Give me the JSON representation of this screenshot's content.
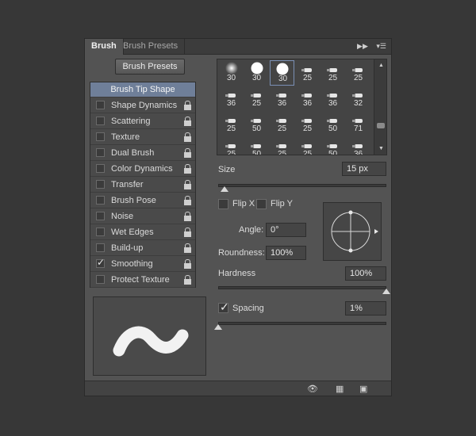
{
  "tabs": {
    "active": "Brush",
    "inactive": "Brush Presets"
  },
  "header_icons": {
    "collapse": "double-arrow-icon",
    "menu": "panel-menu-icon"
  },
  "presets_button": "Brush Presets",
  "list": {
    "header": "Brush Tip Shape",
    "items": [
      {
        "label": "Shape Dynamics",
        "checked": false
      },
      {
        "label": "Scattering",
        "checked": false
      },
      {
        "label": "Texture",
        "checked": false
      },
      {
        "label": "Dual Brush",
        "checked": false
      },
      {
        "label": "Color Dynamics",
        "checked": false
      },
      {
        "label": "Transfer",
        "checked": false
      },
      {
        "label": "Brush Pose",
        "checked": false
      },
      {
        "label": "Noise",
        "checked": false
      },
      {
        "label": "Wet Edges",
        "checked": false
      },
      {
        "label": "Build-up",
        "checked": false
      },
      {
        "label": "Smoothing",
        "checked": true
      },
      {
        "label": "Protect Texture",
        "checked": false
      }
    ]
  },
  "brushes": {
    "rows": [
      [
        "30",
        "30",
        "30",
        "25",
        "25",
        "25"
      ],
      [
        "36",
        "25",
        "36",
        "36",
        "36",
        "32"
      ],
      [
        "25",
        "50",
        "25",
        "25",
        "50",
        "71"
      ],
      [
        "25",
        "50",
        "25",
        "25",
        "50",
        "36"
      ]
    ],
    "selected": [
      0,
      2
    ]
  },
  "size": {
    "label": "Size",
    "value": "15 px",
    "level": 0.04
  },
  "flip": {
    "x_label": "Flip X",
    "y_label": "Flip Y"
  },
  "angle": {
    "label": "Angle:",
    "value": "0°"
  },
  "roundness": {
    "label": "Roundness:",
    "value": "100%"
  },
  "hardness": {
    "label": "Hardness",
    "value": "100%",
    "level": 1.0
  },
  "spacing": {
    "label": "Spacing",
    "value": "1%",
    "checked": true,
    "level": 0.0
  },
  "footer_icons": [
    "eye-brush-icon",
    "grid-icon",
    "new-preset-icon"
  ]
}
